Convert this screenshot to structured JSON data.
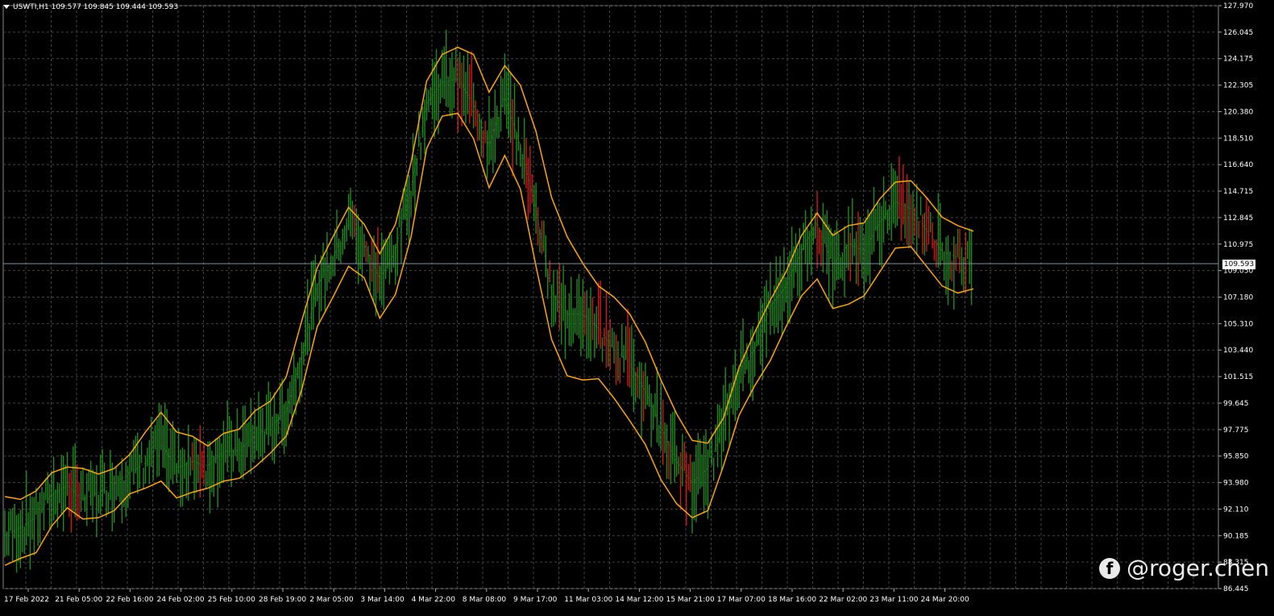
{
  "header": {
    "symbol": "USWTI,H1",
    "ohlc": "109.577 109.845 109.444 109.593"
  },
  "current_price_label": "109.593",
  "watermark": {
    "text": "@roger.chen",
    "icon": "facebook-icon"
  },
  "colors": {
    "background": "#000000",
    "grid": "#444444",
    "axis_text": "#ffffff",
    "band_envelope": "#ffa500",
    "candles_up": "#1e8c1e",
    "candles_down": "#d01818",
    "current_price_line": "#7f8fa0"
  },
  "chart_data": {
    "type": "line",
    "title": "",
    "xlabel": "",
    "ylabel": "",
    "ylim": [
      86.445,
      127.97
    ],
    "grid": true,
    "y_ticks": [
      "127.970",
      "126.045",
      "124.175",
      "122.305",
      "120.380",
      "118.510",
      "116.640",
      "114.715",
      "112.845",
      "110.975",
      "109.050",
      "107.180",
      "105.310",
      "103.440",
      "101.515",
      "99.645",
      "97.775",
      "95.850",
      "93.980",
      "92.110",
      "90.185",
      "88.315",
      "86.445"
    ],
    "x_ticks": [
      "17 Feb 2022",
      "21 Feb 05:00",
      "22 Feb 16:00",
      "24 Feb 02:00",
      "25 Feb 10:00",
      "28 Feb 19:00",
      "2 Mar 05:00",
      "3 Mar 14:00",
      "4 Mar 22:00",
      "8 Mar 08:00",
      "9 Mar 17:00",
      "11 Mar 03:00",
      "14 Mar 12:00",
      "15 Mar 21:00",
      "17 Mar 07:00",
      "18 Mar 16:00",
      "22 Mar 02:00",
      "23 Mar 11:00",
      "24 Mar 20:00"
    ],
    "current_price": 109.593,
    "series": [
      {
        "name": "",
        "values": [
          90.2,
          90.8,
          91.5,
          93.1,
          93.8,
          92.8,
          93.3,
          93.9,
          94.7,
          95.4,
          96.8,
          95.0,
          95.5,
          95.2,
          96.2,
          96.3,
          97.3,
          98.0,
          99.0,
          103.0,
          108.0,
          110.0,
          112.5,
          111.0,
          108.5,
          110.5,
          115.0,
          121.0,
          122.5,
          122.8,
          121.0,
          118.0,
          121.5,
          118.0,
          113.5,
          107.5,
          106.0,
          106.0,
          105.0,
          103.5,
          102.5,
          100.5,
          98.0,
          95.5,
          94.0,
          95.0,
          98.0,
          102.0,
          103.5,
          106.5,
          108.0,
          110.5,
          112.5,
          109.5,
          111.0,
          110.5,
          112.5,
          114.0,
          113.5,
          112.0,
          110.5,
          110.0,
          109.6
        ]
      },
      {
        "name": "",
        "values": [
          93.0,
          92.8,
          93.4,
          94.7,
          95.1,
          95.0,
          94.6,
          95.0,
          96.0,
          97.6,
          99.0,
          97.6,
          97.3,
          96.6,
          97.5,
          97.8,
          99.1,
          99.8,
          101.5,
          105.5,
          109.3,
          111.5,
          113.6,
          112.4,
          110.3,
          112.4,
          116.8,
          122.6,
          124.5,
          125.0,
          124.5,
          121.8,
          123.7,
          122.3,
          119.0,
          114.3,
          111.5,
          109.6,
          108.0,
          107.2,
          106.0,
          104.0,
          101.3,
          98.9,
          97.0,
          96.8,
          98.6,
          102.2,
          104.7,
          107.0,
          109.0,
          111.6,
          113.2,
          111.6,
          112.3,
          112.5,
          114.2,
          115.4,
          115.5,
          114.3,
          112.9,
          112.3,
          111.9
        ]
      },
      {
        "name": "",
        "values": [
          88.1,
          88.6,
          89.0,
          90.9,
          92.2,
          91.4,
          91.5,
          92.0,
          93.2,
          93.6,
          94.1,
          92.9,
          93.3,
          93.6,
          94.1,
          94.3,
          95.1,
          96.1,
          97.3,
          100.6,
          105.1,
          107.2,
          109.4,
          108.6,
          105.7,
          107.4,
          111.5,
          117.8,
          120.1,
          120.3,
          118.5,
          115.0,
          117.3,
          114.9,
          109.4,
          104.2,
          101.6,
          101.3,
          101.4,
          100.0,
          98.4,
          96.7,
          94.2,
          92.5,
          91.5,
          92.0,
          95.2,
          98.8,
          100.9,
          102.7,
          105.1,
          107.3,
          108.5,
          106.4,
          106.7,
          107.3,
          109.0,
          110.7,
          110.8,
          109.4,
          108.0,
          107.5,
          107.8
        ]
      }
    ]
  }
}
